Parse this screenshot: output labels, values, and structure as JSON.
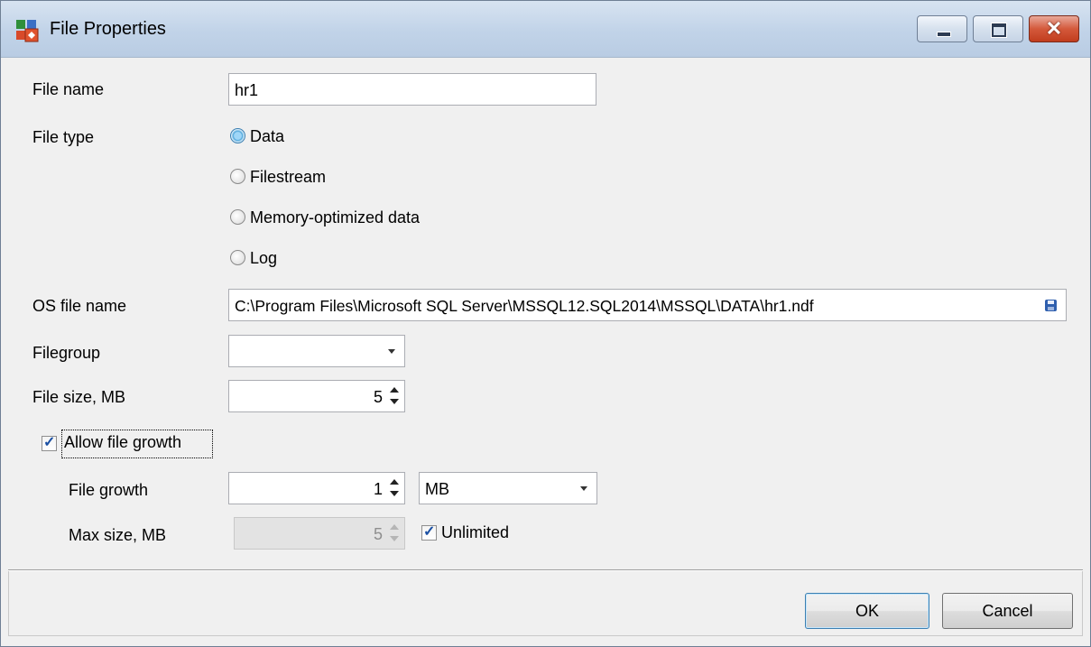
{
  "window": {
    "title": "File Properties"
  },
  "titlebar_buttons": {
    "close_glyph": "✕"
  },
  "form": {
    "file_name": {
      "label": "File name",
      "value": "hr1"
    },
    "file_type": {
      "label": "File type",
      "options": [
        "Data",
        "Filestream",
        "Memory-optimized data",
        "Log"
      ],
      "selected": "Data"
    },
    "os_file_name": {
      "label": "OS file name",
      "value": "C:\\Program Files\\Microsoft SQL Server\\MSSQL12.SQL2014\\MSSQL\\DATA\\hr1.ndf",
      "icon": "save-icon"
    },
    "filegroup": {
      "label": "Filegroup",
      "value": ""
    },
    "file_size": {
      "label": "File size, MB",
      "value": "5"
    },
    "allow_growth": {
      "label": "Allow file growth",
      "checked": true
    },
    "file_growth": {
      "label": "File growth",
      "value": "1",
      "unit": "MB"
    },
    "max_size": {
      "label": "Max size, MB",
      "value": "5",
      "enabled": false
    },
    "unlimited": {
      "label": "Unlimited",
      "checked": true
    }
  },
  "buttons": {
    "ok": "OK",
    "cancel": "Cancel"
  },
  "colors": {
    "titlebar": "#c1d3e8",
    "radio_selected": "#4ea5d9",
    "close": "#c13d1e"
  }
}
